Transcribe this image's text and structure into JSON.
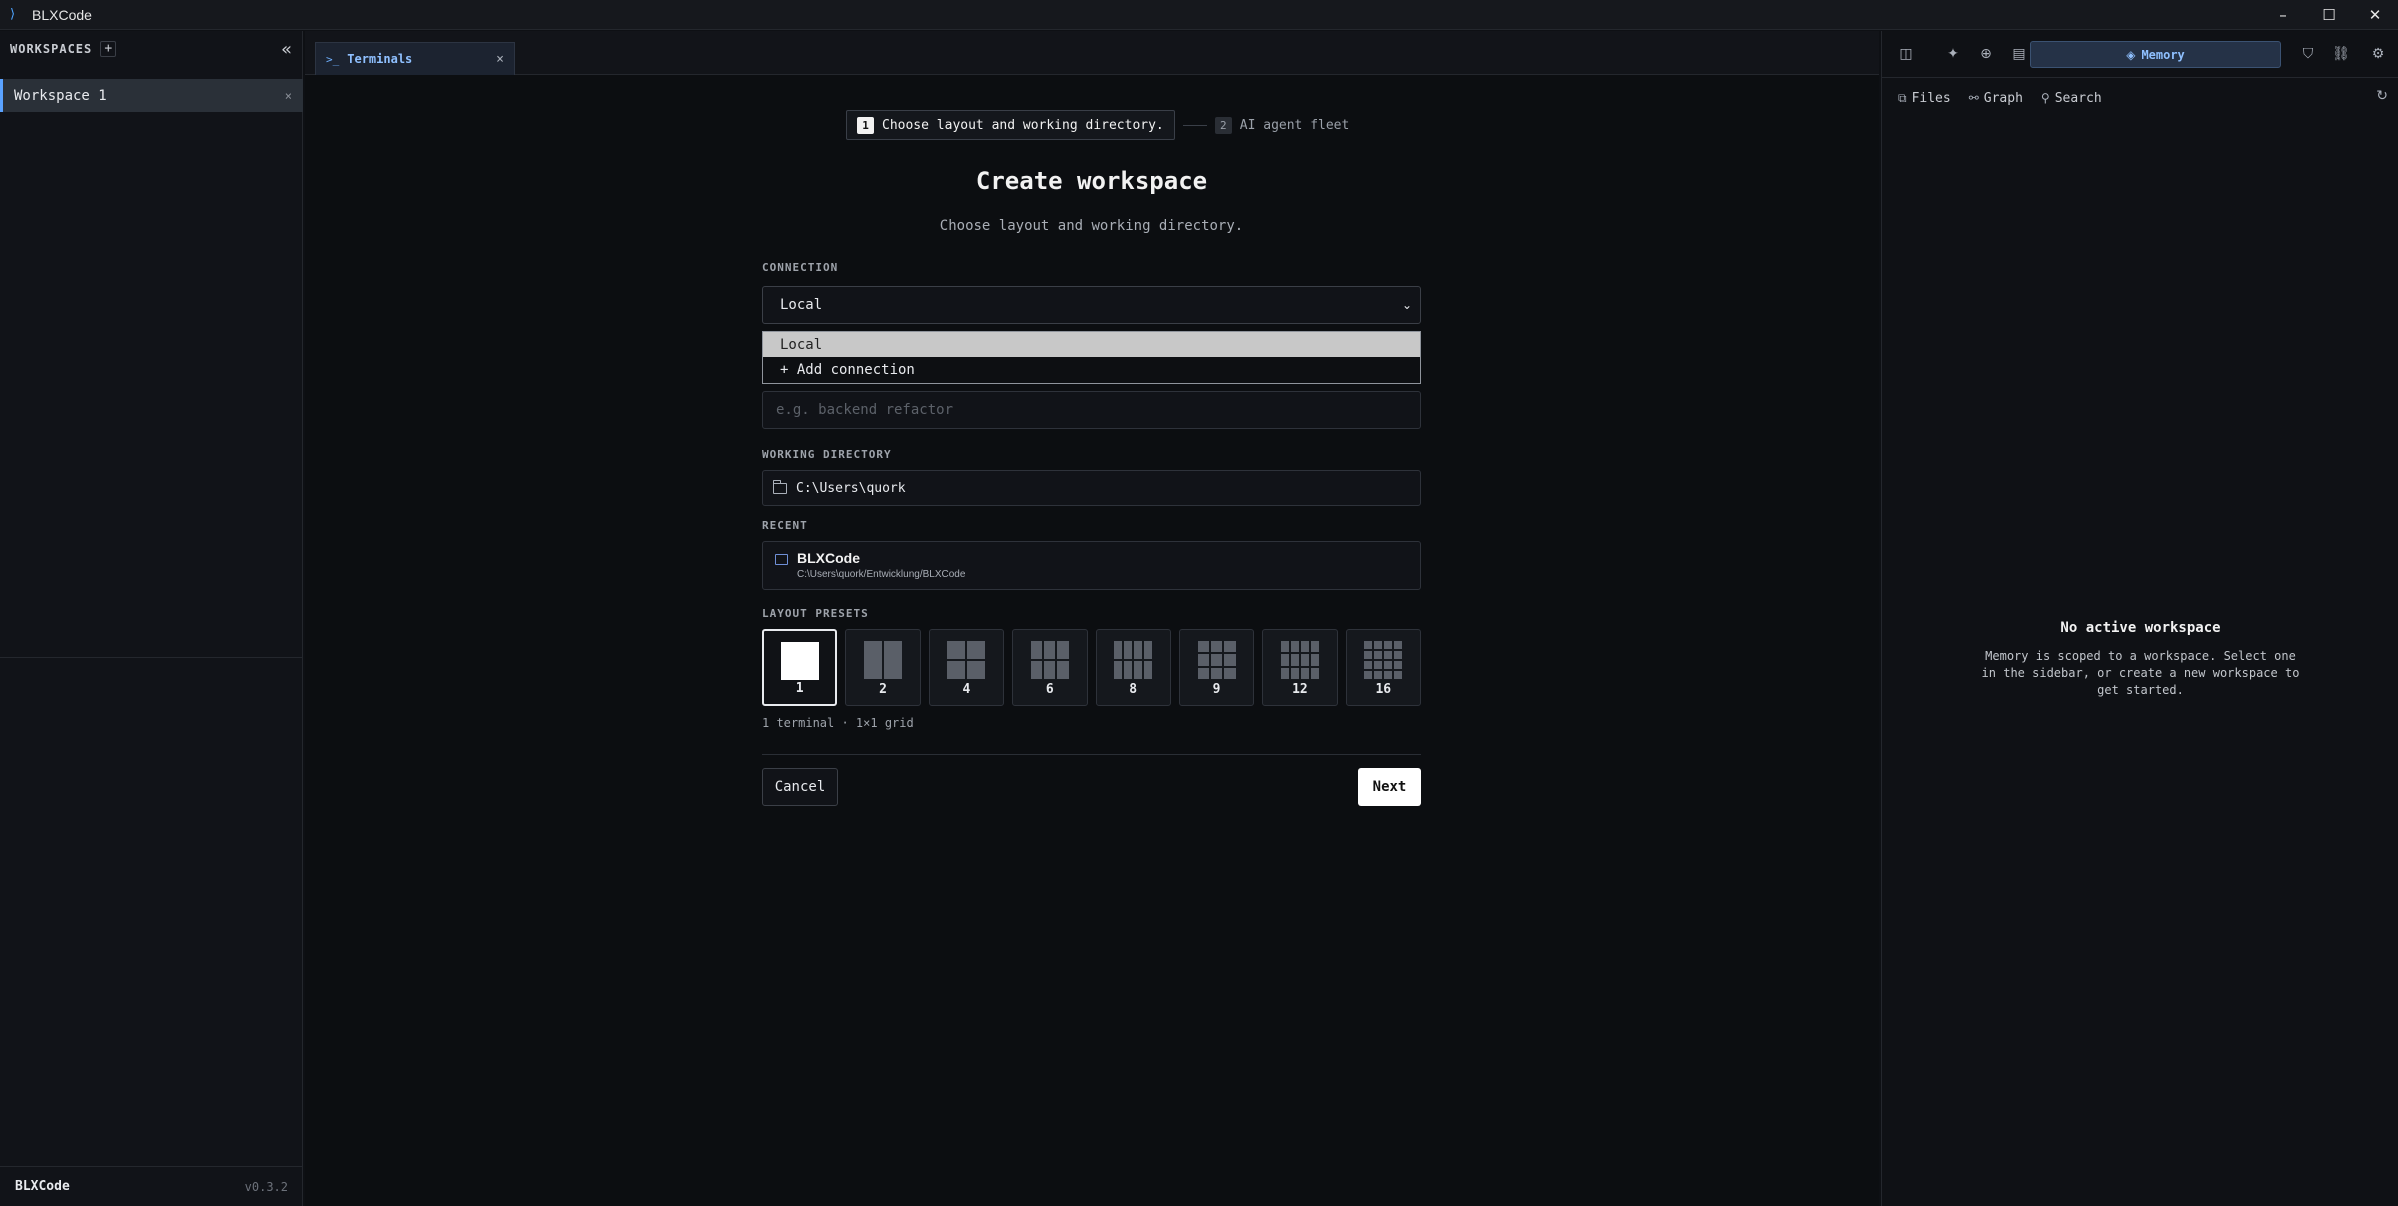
{
  "window": {
    "title": "BLXCode"
  },
  "sidebar": {
    "header": "WORKSPACES",
    "add": "+",
    "collapse": "«",
    "workspaces": [
      {
        "label": "Workspace 1",
        "close": "×"
      }
    ],
    "footer_brand": "BLXCode",
    "version": "v0.3.2"
  },
  "tabs": [
    {
      "icon": ">_",
      "label": "Terminals",
      "close": "×"
    }
  ],
  "wizard": {
    "steps": [
      {
        "num": "1",
        "label": "Choose layout and working directory."
      },
      {
        "num": "2",
        "label": "AI agent fleet"
      }
    ],
    "title": "Create workspace",
    "subtitle": "Choose layout and working directory.",
    "connection": {
      "label": "CONNECTION",
      "selected": "Local",
      "options": [
        "Local",
        "+ Add connection"
      ]
    },
    "name_placeholder": "e.g. backend refactor",
    "working_directory": {
      "label": "WORKING DIRECTORY",
      "value": "C:\\Users\\quork"
    },
    "recent": {
      "label": "RECENT",
      "items": [
        {
          "name": "BLXCode",
          "path": "C:\\Users\\quork/Entwicklung/BLXCode"
        }
      ]
    },
    "layout_presets": {
      "label": "LAYOUT PRESETS",
      "options": [
        "1",
        "2",
        "4",
        "6",
        "8",
        "9",
        "12",
        "16"
      ],
      "selected": "1"
    },
    "summary": "1 terminal · 1×1 grid",
    "cancel": "Cancel",
    "next": "Next"
  },
  "right_panel": {
    "active_tab": "Memory",
    "sub_tabs": [
      "Files",
      "Graph",
      "Search"
    ],
    "empty_title": "No active workspace",
    "empty_desc": "Memory is scoped to a workspace. Select one in the sidebar, or create a new workspace to get started."
  },
  "colors": {
    "accent": "#5aa2ff",
    "background": "#0c0e11"
  }
}
